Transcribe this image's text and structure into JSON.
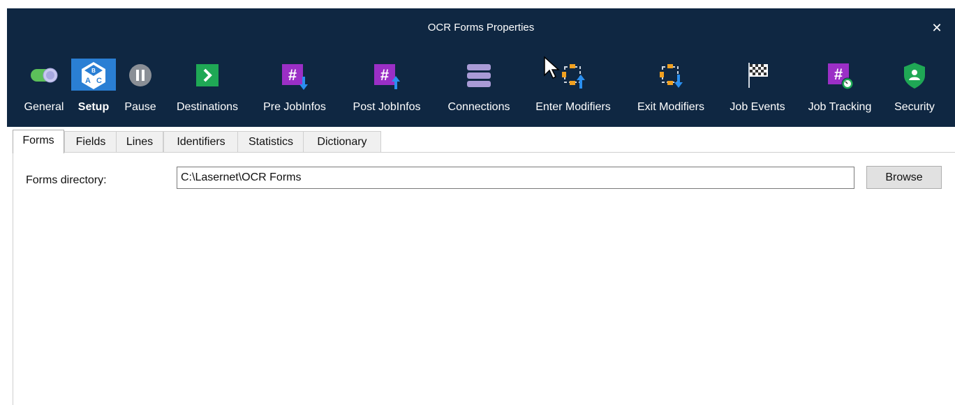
{
  "window": {
    "title": "OCR Forms Properties",
    "close_glyph": "✕"
  },
  "toolbar": {
    "items": [
      {
        "label": "General",
        "icon": "toggle-icon",
        "active": false
      },
      {
        "label": "Setup",
        "icon": "setup-abc-icon",
        "active": true
      },
      {
        "label": "Pause",
        "icon": "pause-icon",
        "active": false
      },
      {
        "label": "Destinations",
        "icon": "destinations-arrow-icon",
        "active": false
      },
      {
        "label": "Pre JobInfos",
        "icon": "pre-jobinfos-icon",
        "active": false
      },
      {
        "label": "Post JobInfos",
        "icon": "post-jobinfos-icon",
        "active": false
      },
      {
        "label": "Connections",
        "icon": "connections-stack-icon",
        "active": false
      },
      {
        "label": "Enter Modifiers",
        "icon": "enter-modifiers-icon",
        "active": false
      },
      {
        "label": "Exit Modifiers",
        "icon": "exit-modifiers-icon",
        "active": false
      },
      {
        "label": "Job Events",
        "icon": "checkered-flag-icon",
        "active": false
      },
      {
        "label": "Job Tracking",
        "icon": "job-tracking-icon",
        "active": false
      },
      {
        "label": "Security",
        "icon": "shield-user-icon",
        "active": false
      }
    ]
  },
  "tabs": [
    {
      "label": "Forms",
      "active": true
    },
    {
      "label": "Fields",
      "active": false
    },
    {
      "label": "Lines",
      "active": false
    },
    {
      "label": "Identifiers",
      "active": false
    },
    {
      "label": "Statistics",
      "active": false
    },
    {
      "label": "Dictionary",
      "active": false
    }
  ],
  "forms": {
    "directory_label": "Forms directory:",
    "directory_value": "C:\\Lasernet\\OCR Forms",
    "browse_label": "Browse"
  },
  "colors": {
    "titlebar": "#0f2742",
    "active_tool": "#2a7fd4",
    "green": "#1fa855",
    "purple": "#9b2fc6",
    "blue_arrow": "#2a8ff0",
    "orange": "#f0a020",
    "lavender": "#a99bd6"
  }
}
